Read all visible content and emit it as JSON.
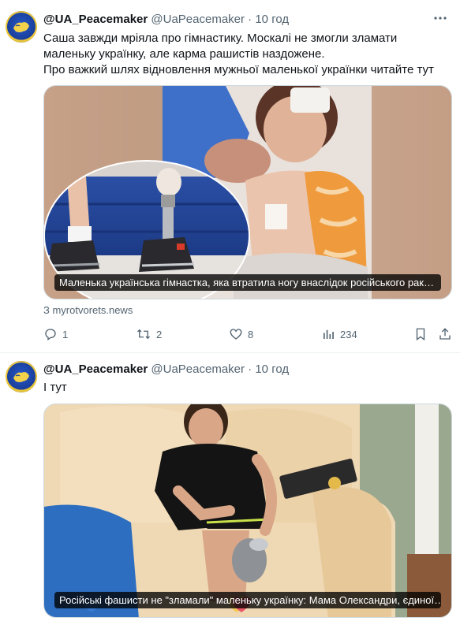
{
  "tweets": [
    {
      "display_name": "@UA_Peacemaker",
      "handle": "@UaPeacemaker",
      "separator": "·",
      "time": "10 год",
      "more_icon": "more-dots-icon",
      "text_lines": [
        "Саша завжди мріяла про гімнастику. Москалі не змогли зламати",
        "маленьку українку, але карма рашистів наздожене.",
        "Про важкий шлях відновлення мужньої маленької українки читайте тут"
      ],
      "media_caption": "Маленька українська гімнастка, яка втратила ногу внаслідок російського рак…",
      "card_source": "З myrotvorets.news",
      "actions": {
        "reply_count": "1",
        "retweet_count": "2",
        "like_count": "8",
        "views_count": "234"
      }
    },
    {
      "display_name": "@UA_Peacemaker",
      "handle": "@UaPeacemaker",
      "separator": "·",
      "time": "10 год",
      "text": "І тут",
      "media_caption": "Російські фашисти не \"зламали\" маленьку українку: Мама Олександри, єдиної…"
    }
  ],
  "colors": {
    "text_primary": "#0f1419",
    "text_secondary": "#536471",
    "border": "#cfd9de"
  }
}
